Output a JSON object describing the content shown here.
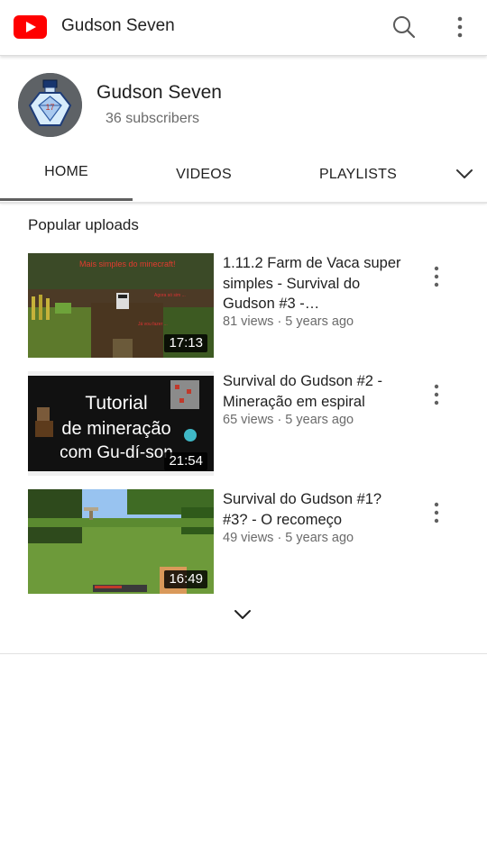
{
  "appbar": {
    "title": "Gudson Seven",
    "logo_icon": "youtube-logo-icon",
    "search_icon": "search-icon",
    "more_icon": "more-vert-icon"
  },
  "channel": {
    "name": "Gudson Seven",
    "subscribers": "36 subscribers"
  },
  "tabs": {
    "items": [
      {
        "label": "HOME",
        "selected": true
      },
      {
        "label": "VIDEOS",
        "selected": false
      },
      {
        "label": "PLAYLISTS",
        "selected": false
      }
    ],
    "more_icon": "chevron-down-icon"
  },
  "section": {
    "title": "Popular uploads"
  },
  "videos": [
    {
      "title": "1.11.2 Farm de Vaca super simples - Survival do Gudson #3 -…",
      "meta": "81 views · 5 years ago",
      "duration": "17:13",
      "thumb_text": "Mais simples do minecraft!"
    },
    {
      "title": "Survival do Gudson #2 - Mineração em espiral",
      "meta": "65 views · 5 years ago",
      "duration": "21:54",
      "thumb_text_line1": "Tutorial",
      "thumb_text_line2": "de mineração",
      "thumb_text_line3": "com Gu-dí-son"
    },
    {
      "title": "Survival do Gudson #1? #3? - O recomeço",
      "meta": "49 views · 5 years ago",
      "duration": "16:49"
    }
  ],
  "colors": {
    "brand_red": "#ff0000",
    "tab_indicator": "#5f5f5f",
    "secondary_text": "#6b6b6b"
  }
}
